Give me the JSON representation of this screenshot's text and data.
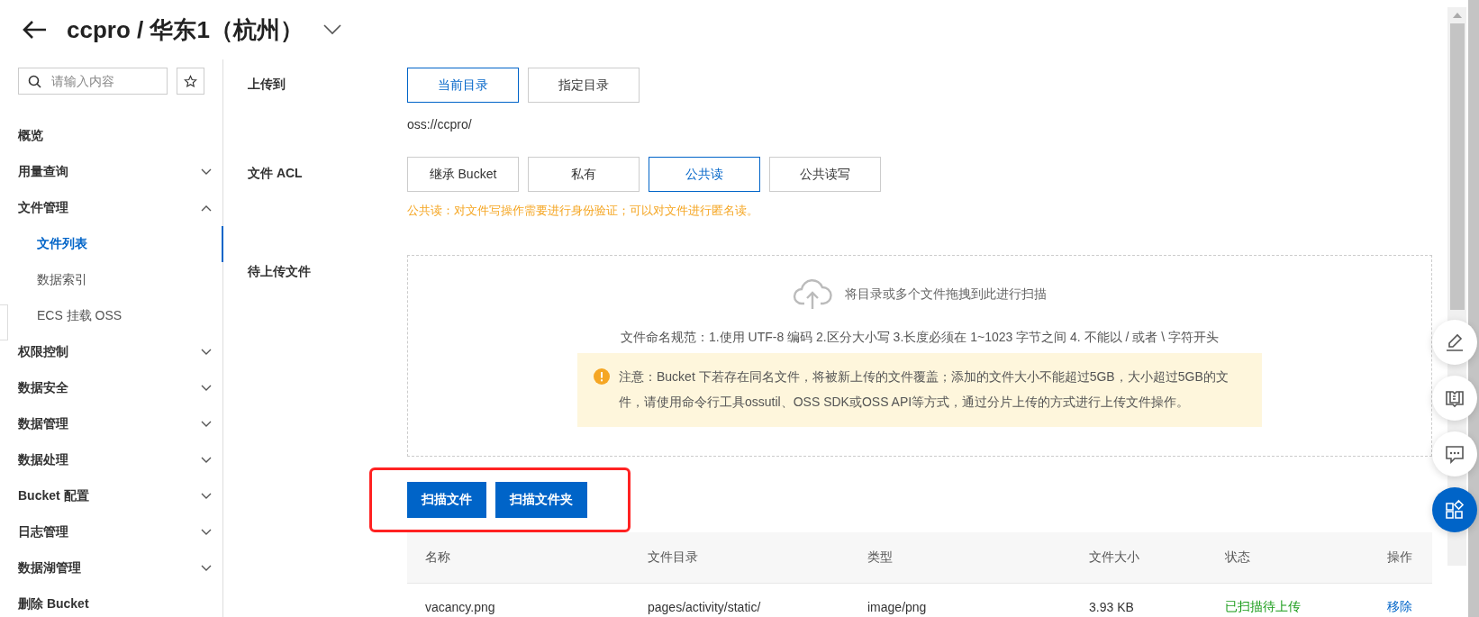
{
  "header": {
    "title": "ccpro / 华东1（杭州）"
  },
  "sidebar": {
    "search": {
      "placeholder": "请输入内容"
    },
    "items": [
      {
        "label": "概览",
        "kind": "link",
        "selected": false
      },
      {
        "label": "用量查询",
        "kind": "group",
        "expanded": false,
        "selected": false
      },
      {
        "label": "文件管理",
        "kind": "group",
        "expanded": true,
        "selected": false,
        "children": [
          {
            "label": "文件列表",
            "selected": true
          },
          {
            "label": "数据索引",
            "selected": false
          },
          {
            "label": "ECS 挂载 OSS",
            "selected": false
          }
        ]
      },
      {
        "label": "权限控制",
        "kind": "group",
        "expanded": false,
        "selected": false
      },
      {
        "label": "数据安全",
        "kind": "group",
        "expanded": false,
        "selected": false
      },
      {
        "label": "数据管理",
        "kind": "group",
        "expanded": false,
        "selected": false
      },
      {
        "label": "数据处理",
        "kind": "group",
        "expanded": false,
        "selected": false
      },
      {
        "label": "Bucket 配置",
        "kind": "group",
        "expanded": false,
        "selected": false
      },
      {
        "label": "日志管理",
        "kind": "group",
        "expanded": false,
        "selected": false
      },
      {
        "label": "数据湖管理",
        "kind": "group",
        "expanded": false,
        "selected": false
      },
      {
        "label": "删除 Bucket",
        "kind": "link",
        "selected": false
      }
    ]
  },
  "form": {
    "upload_to": {
      "label": "上传到",
      "options": [
        {
          "label": "当前目录",
          "selected": true
        },
        {
          "label": "指定目录",
          "selected": false
        }
      ],
      "path": "oss://ccpro/"
    },
    "acl": {
      "label": "文件 ACL",
      "options": [
        {
          "label": "继承 Bucket",
          "selected": false
        },
        {
          "label": "私有",
          "selected": false
        },
        {
          "label": "公共读",
          "selected": true
        },
        {
          "label": "公共读写",
          "selected": false
        }
      ],
      "hint": "公共读：对文件写操作需要进行身份验证；可以对文件进行匿名读。"
    },
    "files": {
      "label": "待上传文件",
      "drop_text": "将目录或多个文件拖拽到此进行扫描",
      "rules": "文件命名规范：1.使用 UTF-8 编码 2.区分大小写 3.长度必须在 1~1023 字节之间 4. 不能以 / 或者 \\ 字符开头",
      "notice": "注意：Bucket 下若存在同名文件，将被新上传的文件覆盖；添加的文件大小不能超过5GB，大小超过5GB的文件，请使用命令行工具ossutil、OSS SDK或OSS API等方式，通过分片上传的方式进行上传文件操作。"
    },
    "buttons": [
      "扫描文件",
      "扫描文件夹"
    ]
  },
  "table": {
    "columns": [
      "名称",
      "文件目录",
      "类型",
      "文件大小",
      "状态",
      "操作"
    ],
    "rows": [
      {
        "name": "vacancy.png",
        "directory": "pages/activity/static/",
        "type": "image/png",
        "size": "3.93 KB",
        "status": "已扫描待上传",
        "action": "移除"
      }
    ]
  }
}
